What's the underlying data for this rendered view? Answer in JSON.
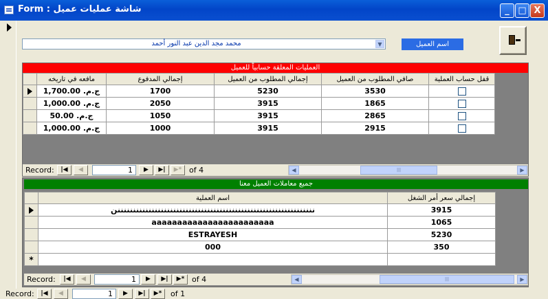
{
  "window": {
    "title": "Form : شاشة عمليات عميل",
    "minimize": "_",
    "maximize": "□",
    "close": "X"
  },
  "customer": {
    "label": "اسم العميل",
    "selected": "محمد مجد الدين عبد النور أحمد",
    "dropdown_arrow": "▼",
    "exit_icon": "exit-door-icon"
  },
  "pending": {
    "caption": "العمليات المعلقة حسابياً للعميل",
    "columns": [
      "مافعه في تاريخه",
      "إجمالي المدفوع",
      "إجمالي المطلوب من العميل",
      "صافي المطلوب من العميل",
      "قفل حساب العملية"
    ],
    "rows": [
      {
        "paid_on_date": "ج.م. 1,700.00",
        "total_paid": "1700",
        "total_required": "5230",
        "net_required": "3530",
        "closed": false,
        "current": true
      },
      {
        "paid_on_date": "ج.م. 1,000.00",
        "total_paid": "2050",
        "total_required": "3915",
        "net_required": "1865",
        "closed": false,
        "current": false
      },
      {
        "paid_on_date": "ج.م. 50.00",
        "total_paid": "1050",
        "total_required": "3915",
        "net_required": "2865",
        "closed": false,
        "current": false
      },
      {
        "paid_on_date": "ج.م. 1,000.00",
        "total_paid": "1000",
        "total_required": "3915",
        "net_required": "2915",
        "closed": false,
        "current": false
      }
    ],
    "nav": {
      "label": "Record:",
      "current": "1",
      "of": "of 4"
    }
  },
  "transactions": {
    "caption": "جميع معاملات العميل معنا",
    "columns": [
      "اسم العملية",
      "إجمالي سعر أمر الشغل"
    ],
    "rows": [
      {
        "name": "ننننننننننننننننننننننننننننننننننننننننننننننننننننننننننننننننن",
        "total": "3915",
        "current": true
      },
      {
        "name": "aaaaaaaaaaaaaaaaaaaaaaaa",
        "total": "1065",
        "current": false
      },
      {
        "name": "ESTRAYESH",
        "total": "5230",
        "current": false
      },
      {
        "name": "000",
        "total": "350",
        "current": false
      }
    ],
    "new_row_marker": "*",
    "nav": {
      "label": "Record:",
      "current": "1",
      "of": "of 4"
    }
  },
  "form_nav": {
    "label": "Record:",
    "current": "1",
    "of": "of 1"
  },
  "nav_glyphs": {
    "first": "|◀",
    "prev": "◀",
    "next": "▶",
    "last": "▶|",
    "new": "▶*",
    "left": "◀",
    "right": "▶",
    "thumb": "|||"
  }
}
